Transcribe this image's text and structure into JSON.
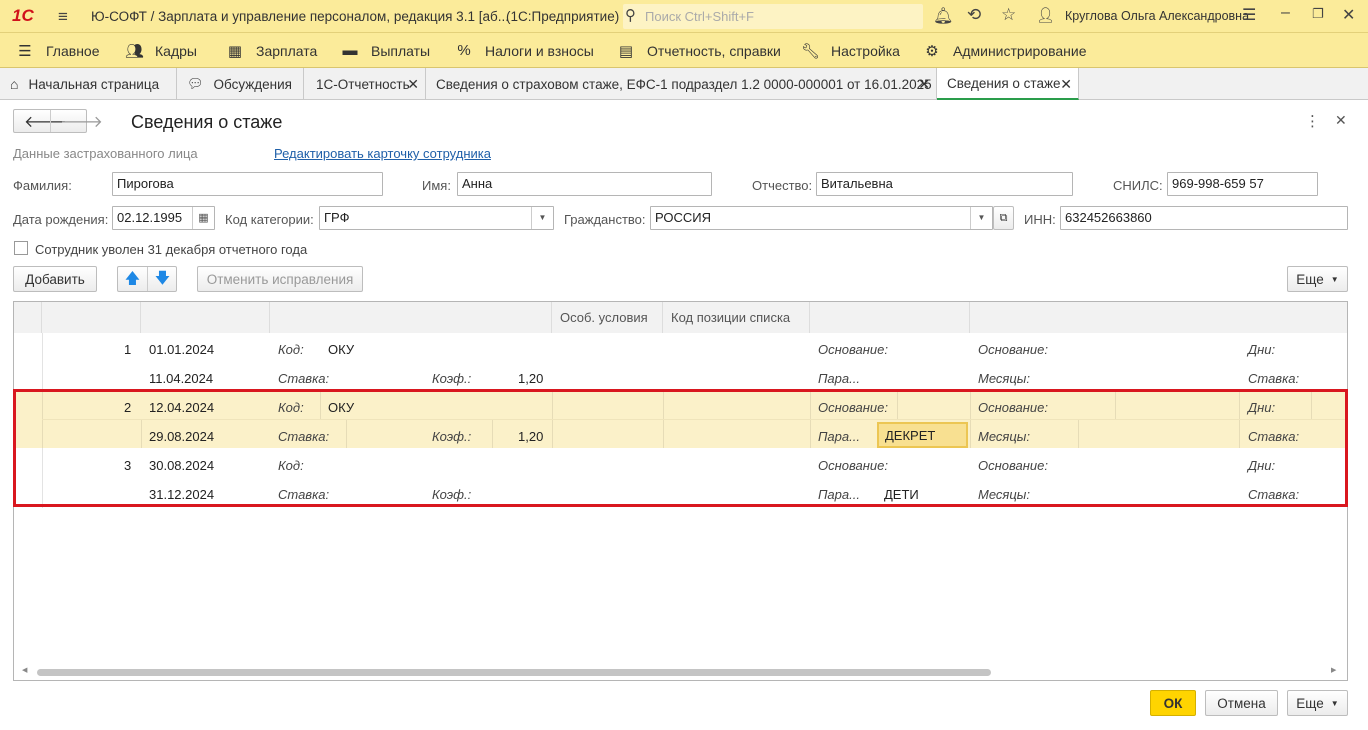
{
  "app": {
    "logo": "1С",
    "title": "Ю-СОФТ / Зарплата и управление персоналом, редакция 3.1 [аб...",
    "platform": "(1С:Предприятие)",
    "search_placeholder": "Поиск Ctrl+Shift+F",
    "user": "Круглова Ольга Александровна"
  },
  "menu": [
    {
      "label": "Главное",
      "icon": "hamburger-icon"
    },
    {
      "label": "Кадры",
      "icon": "people-icon"
    },
    {
      "label": "Зарплата",
      "icon": "calculator-icon"
    },
    {
      "label": "Выплаты",
      "icon": "wallet-icon"
    },
    {
      "label": "Налоги и взносы",
      "icon": "percent-icon"
    },
    {
      "label": "Отчетность, справки",
      "icon": "document-icon"
    },
    {
      "label": "Настройка",
      "icon": "wrench-icon"
    },
    {
      "label": "Администрирование",
      "icon": "gear-icon"
    }
  ],
  "tabs": [
    {
      "label": "Начальная страница"
    },
    {
      "label": "Обсуждения"
    },
    {
      "label": "1С-Отчетность"
    },
    {
      "label": "Сведения о страховом стаже, ЕФС-1 подраздел 1.2 0000-000001 от 16.01.2025"
    },
    {
      "label": "Сведения о стаже"
    }
  ],
  "form": {
    "title": "Сведения о стаже",
    "section_label": "Данные застрахованного лица",
    "edit_link": "Редактировать карточку сотрудника",
    "surname_label": "Фамилия:",
    "surname": "Пирогова",
    "name_label": "Имя:",
    "name": "Анна",
    "patronymic_label": "Отчество:",
    "patronymic": "Витальевна",
    "snils_label": "СНИЛС:",
    "snils": "969-998-659 57",
    "birth_label": "Дата рождения:",
    "birth": "02.12.1995",
    "category_label": "Код категории:",
    "category": "ГРФ",
    "citizenship_label": "Гражданство:",
    "citizenship": "РОССИЯ",
    "inn_label": "ИНН:",
    "inn": "632452663860",
    "dismissed_label": "Сотрудник уволен 31 декабря отчетного года",
    "add_button": "Добавить",
    "cancel_fix_button": "Отменить исправления",
    "more_button": "Еще",
    "ok_button": "ОК",
    "cancel_button": "Отмена"
  },
  "grid": {
    "headers": [
      "Особ. условия",
      "Код позиции списка"
    ],
    "labels": {
      "code": "Код:",
      "rate": "Ставка:",
      "coef": "Коэф.:",
      "basis": "Основание:",
      "param": "Пара...",
      "months": "Месяцы:",
      "days": "Дни:"
    },
    "rows": [
      {
        "n": "1",
        "from": "01.01.2024",
        "to": "11.04.2024",
        "code": "ОКУ",
        "coef": "1,20",
        "param": ""
      },
      {
        "n": "2",
        "from": "12.04.2024",
        "to": "29.08.2024",
        "code": "ОКУ",
        "coef": "1,20",
        "param": "ДЕКРЕТ"
      },
      {
        "n": "3",
        "from": "30.08.2024",
        "to": "31.12.2024",
        "code": "",
        "coef": "",
        "param": "ДЕТИ"
      }
    ]
  },
  "colors": {
    "accent": "#fbeb9a",
    "highlight": "#d9171f",
    "ok": "#ffd400"
  }
}
